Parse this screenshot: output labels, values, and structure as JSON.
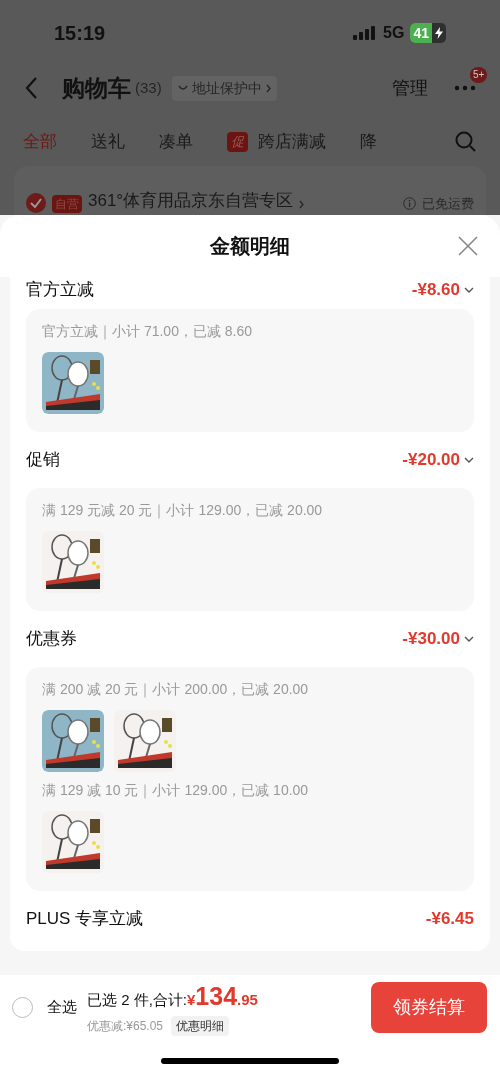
{
  "status_bar": {
    "time": "15:19",
    "network": "5G",
    "battery": "41"
  },
  "nav": {
    "title": "购物车",
    "count": "(33)",
    "address_chip": "地址保护中",
    "manage": "管理",
    "badge": "5+"
  },
  "tabs": [
    {
      "label": "全部",
      "selected": true
    },
    {
      "label": "送礼",
      "selected": false
    },
    {
      "label": "凑单",
      "selected": false
    },
    {
      "label": "跨店满减",
      "selected": false,
      "tag": "促"
    },
    {
      "label": "降",
      "selected": false
    }
  ],
  "store": {
    "checked": true,
    "tag": "自营",
    "name": "361°体育用品京东自营专区",
    "shipping": "已免运费"
  },
  "sheet": {
    "title": "金额明细",
    "sections": [
      {
        "title": "官方立减",
        "amount": "-¥8.60",
        "expandable": true,
        "groups": [
          {
            "label": "官方立减｜小计 71.00，已减 8.60",
            "pictures": [
              {
                "color": "#8fb6c6"
              }
            ]
          }
        ]
      },
      {
        "title": "促销",
        "amount": "-¥20.00",
        "expandable": true,
        "groups": [
          {
            "label": "满 129 元减 20 元｜小计 129.00，已减 20.00",
            "pictures": [
              {
                "color": "#f4f1ee"
              }
            ]
          }
        ]
      },
      {
        "title": "优惠券",
        "amount": "-¥30.00",
        "expandable": true,
        "groups": [
          {
            "label": "满 200 减 20 元｜小计 200.00，已减 20.00",
            "pictures": [
              {
                "color": "#8fb6c6"
              },
              {
                "color": "#f4f1ee"
              }
            ]
          },
          {
            "label": "满 129 减 10 元｜小计 129.00，已减 10.00",
            "pictures": [
              {
                "color": "#f4f1ee"
              }
            ]
          }
        ]
      },
      {
        "title": "PLUS 专享立减",
        "amount": "-¥6.45",
        "expandable": false
      }
    ]
  },
  "footer": {
    "select_all": "全选",
    "select_all_checked": false,
    "selected_text": "已选 2 件,合计:",
    "currency": "¥",
    "total_int": "134",
    "total_dec": ".95",
    "discount": "优惠减:¥65.05",
    "detail_chip": "优惠明细",
    "checkout": "领券结算"
  }
}
